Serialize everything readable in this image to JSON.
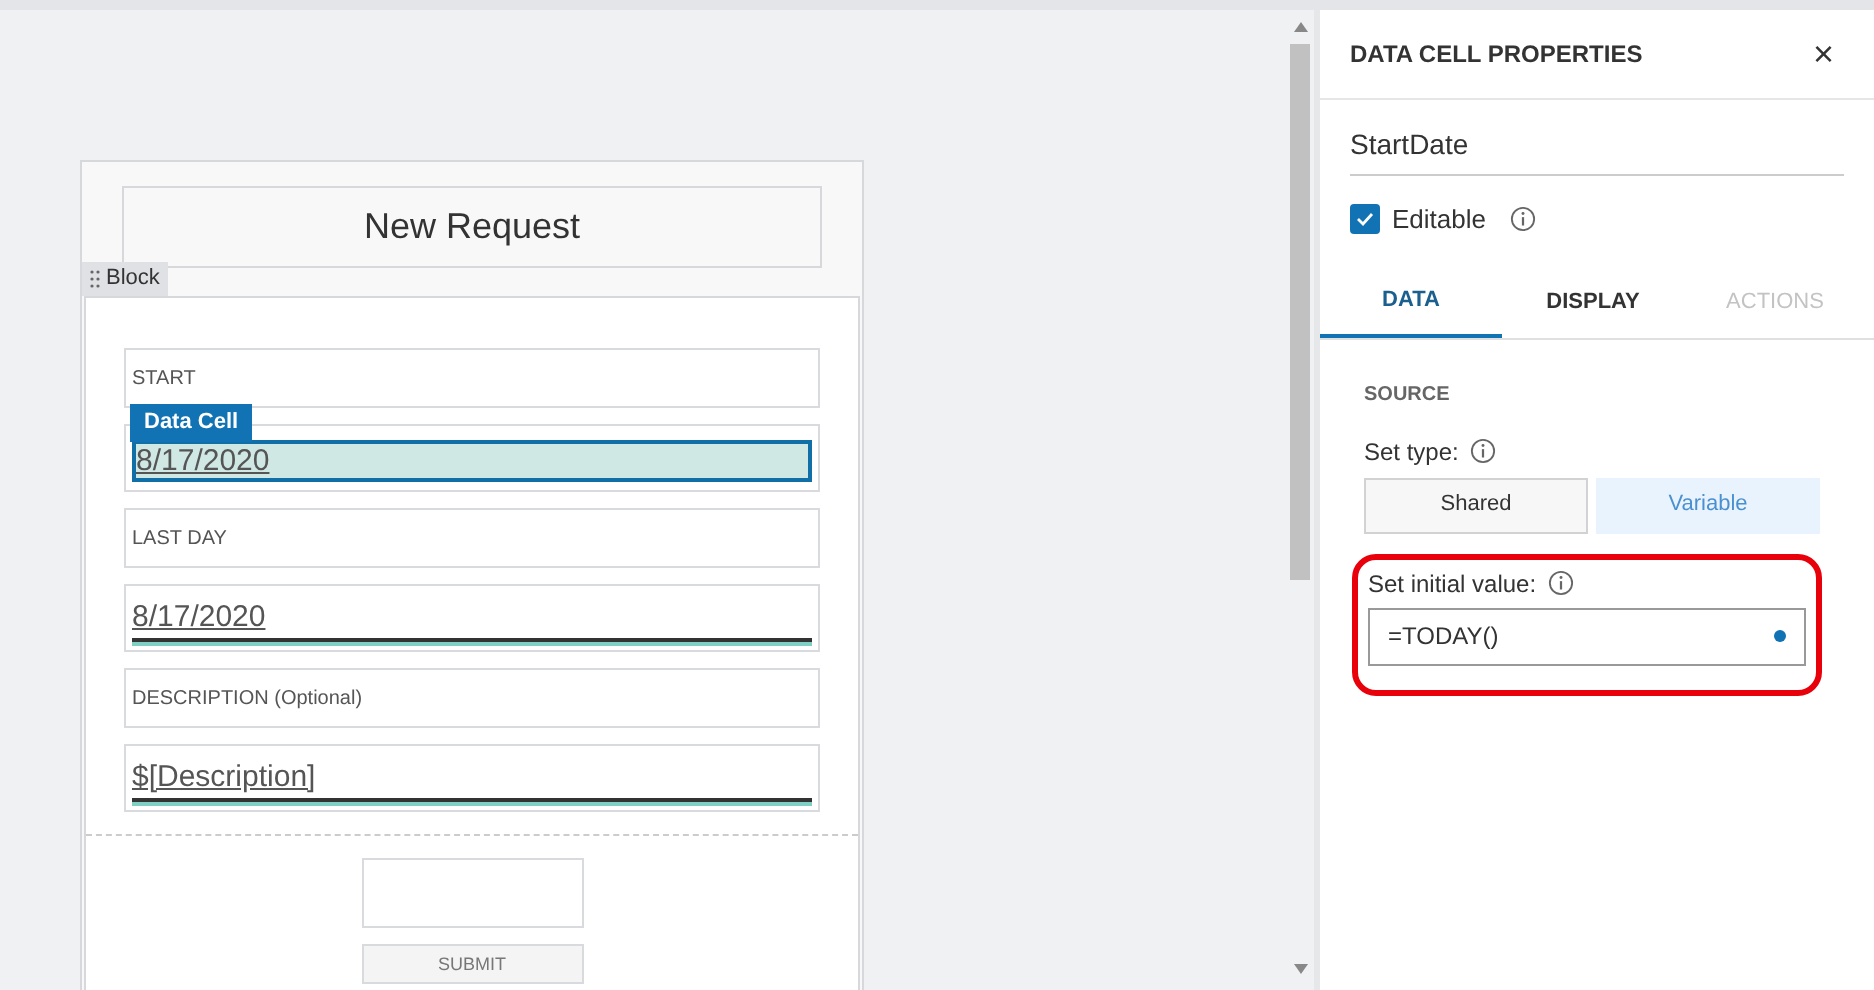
{
  "form": {
    "title": "New Request",
    "block_label": "Block",
    "cells": [
      {
        "kind": "label",
        "text": "START"
      },
      {
        "kind": "value",
        "text": "8/17/2020",
        "selected": true,
        "tag": "Data Cell"
      },
      {
        "kind": "label",
        "text": "LAST DAY"
      },
      {
        "kind": "value",
        "text": "8/17/2020",
        "selected": false
      },
      {
        "kind": "label",
        "text": "DESCRIPTION (Optional)"
      },
      {
        "kind": "value",
        "text": "$[Description]",
        "selected": false
      }
    ],
    "submit_button": "SUBMIT"
  },
  "panel": {
    "title": "DATA CELL PROPERTIES",
    "close": "×",
    "name": "StartDate",
    "editable": {
      "label": "Editable",
      "checked": true
    },
    "tabs": [
      {
        "label": "DATA",
        "selected": true,
        "disabled": false
      },
      {
        "label": "DISPLAY",
        "selected": false,
        "disabled": false
      },
      {
        "label": "ACTIONS",
        "selected": false,
        "disabled": true
      }
    ],
    "section": "SOURCE",
    "set_type": {
      "label": "Set type:",
      "options": [
        {
          "label": "Shared",
          "selected": false
        },
        {
          "label": "Variable",
          "selected": true
        }
      ]
    },
    "initial_value": {
      "label": "Set initial value:",
      "value": "=TODAY()",
      "highlighted": true
    }
  }
}
